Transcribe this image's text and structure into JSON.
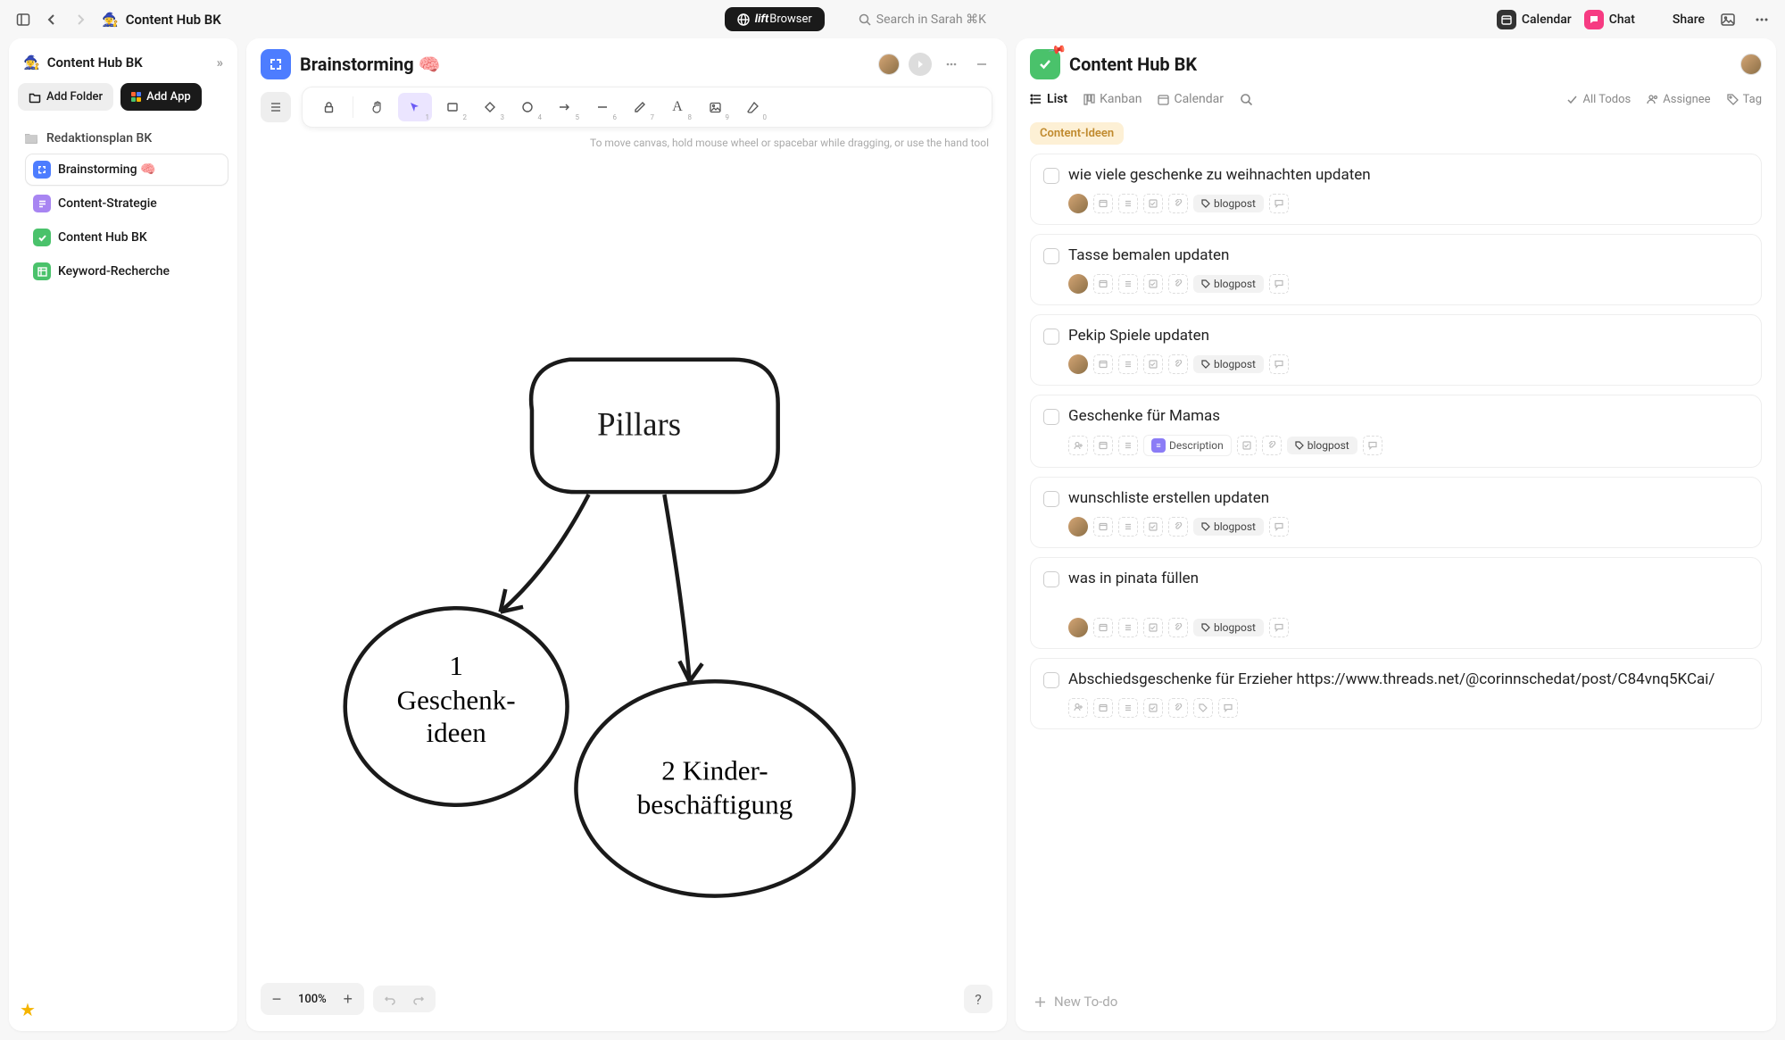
{
  "topbar": {
    "title": "Content Hub BK",
    "browser_label_bold": "lift",
    "browser_label_rest": "Browser",
    "search_placeholder": "Search in Sarah  ⌘K",
    "calendar": "Calendar",
    "chat": "Chat",
    "share": "Share"
  },
  "sidebar": {
    "title": "Content Hub BK",
    "add_folder": "Add Folder",
    "add_app": "Add App",
    "folder": "Redaktionsplan BK",
    "items": [
      {
        "label": "Brainstorming 🧠",
        "color": "#4d7dff"
      },
      {
        "label": "Content-Strategie",
        "color": "#a885f2"
      },
      {
        "label": "Content Hub BK",
        "color": "#4ac26b"
      },
      {
        "label": "Keyword-Recherche",
        "color": "#4ac26b"
      }
    ]
  },
  "center": {
    "title": "Brainstorming 🧠",
    "hint": "To move canvas, hold mouse wheel or spacebar while dragging, or use the hand tool",
    "zoom": "100%",
    "node_pillars": "Pillars",
    "node1a": "1",
    "node1b": "Geschenk-",
    "node1c": "ideen",
    "node2a": "2 Kinder-",
    "node2b": "beschäftigung",
    "tool_subs": [
      "1",
      "2",
      "3",
      "4",
      "5",
      "6",
      "7",
      "8",
      "9",
      "0"
    ]
  },
  "right": {
    "title": "Content Hub BK",
    "views": {
      "list": "List",
      "kanban": "Kanban",
      "calendar": "Calendar"
    },
    "filters": {
      "all": "All Todos",
      "assignee": "Assignee",
      "tag": "Tag"
    },
    "section": "Content-Ideen",
    "tag_blogpost": "blogpost",
    "desc_label": "Description",
    "todos": [
      {
        "text": "wie viele geschenke zu weihnachten updaten",
        "avatar": true,
        "tag": true
      },
      {
        "text": "Tasse bemalen updaten",
        "avatar": true,
        "tag": true
      },
      {
        "text": "Pekip Spiele updaten",
        "avatar": true,
        "tag": true
      },
      {
        "text": "Geschenke für Mamas",
        "avatar": false,
        "tag": true,
        "desc": true
      },
      {
        "text": "wunschliste erstellen updaten",
        "avatar": true,
        "tag": true
      },
      {
        "text": "was in pinata füllen",
        "avatar": true,
        "tag": true,
        "gap": true
      },
      {
        "text": "Abschiedsgeschenke für Erzieher https://www.threads.net/@corinnschedat/post/C84vnq5KCai/",
        "avatar": false,
        "tag": false
      }
    ],
    "new_todo": "New To-do"
  }
}
